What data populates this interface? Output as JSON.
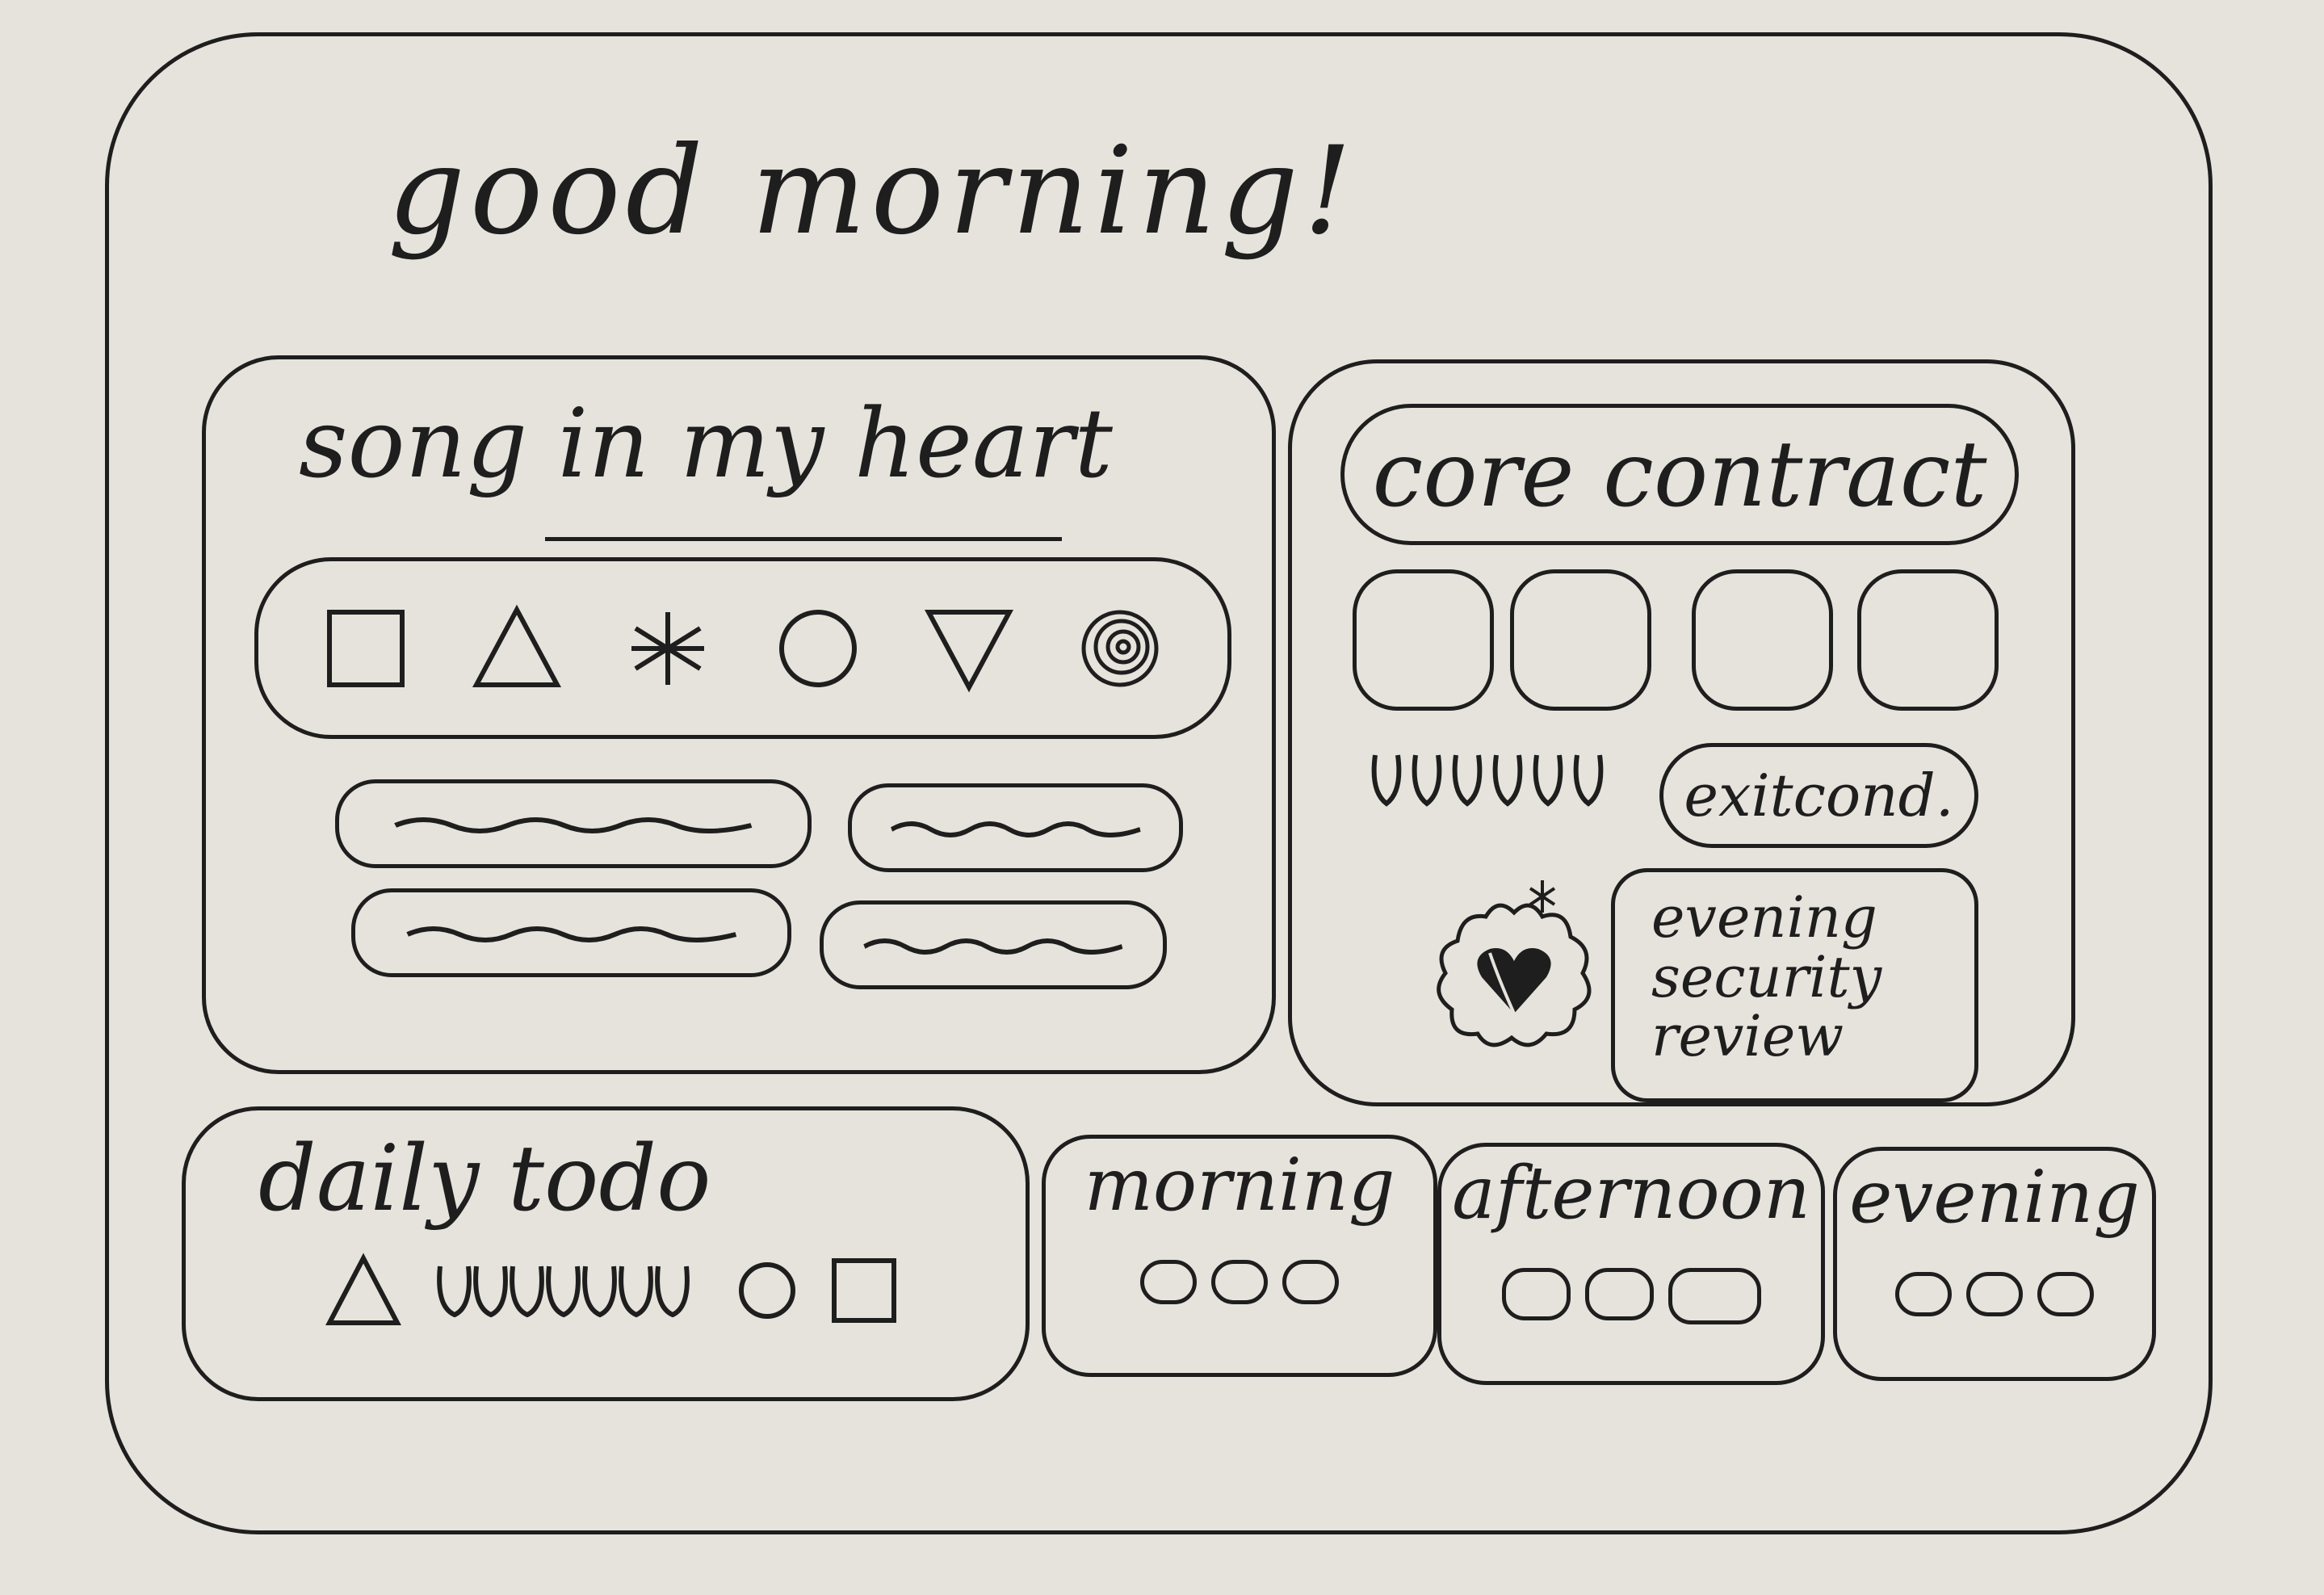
{
  "greeting": "good morning!",
  "song_panel": {
    "title": "song in my heart",
    "shapes": [
      "square-icon",
      "triangle-icon",
      "asterisk-icon",
      "circle-icon",
      "inverted-triangle-icon",
      "spiral-icon"
    ]
  },
  "core_panel": {
    "title": "core contract",
    "exit_label": "exitcond.",
    "review_label": "evening security review"
  },
  "todo_panel": {
    "title": "daily todo"
  },
  "periods": {
    "morning": "morning",
    "afternoon": "afternoon",
    "evening": "evening"
  }
}
